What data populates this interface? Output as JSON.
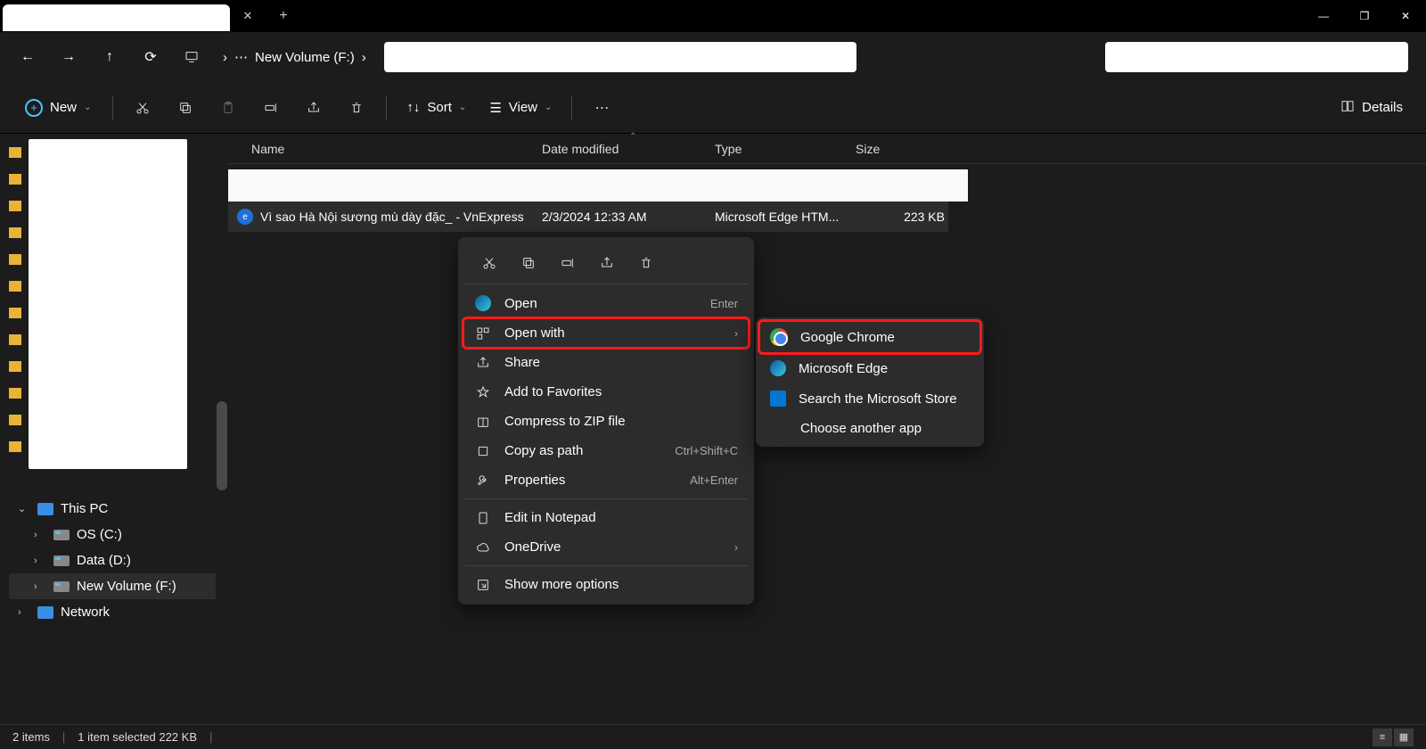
{
  "titlebar": {
    "close": "✕",
    "new": "+",
    "min": "—",
    "max": "❐"
  },
  "nav": {
    "back": "←",
    "fwd": "→",
    "up": "↑",
    "refresh": "⟳"
  },
  "breadcrumb": {
    "location": "New Volume (F:)",
    "chev": "›"
  },
  "toolbar": {
    "new": "New",
    "sort": "Sort",
    "view": "View",
    "details": "Details",
    "cut": "✂",
    "copy": "⧉",
    "paste": "📋",
    "rename": "✎",
    "share": "↗",
    "delete": "🗑",
    "more": "⋯"
  },
  "columns": {
    "name": "Name",
    "date": "Date modified",
    "type": "Type",
    "size": "Size"
  },
  "file": {
    "name": "Vì sao Hà Nội sương mù dày đặc_ - VnExpress",
    "date": "2/3/2024 12:33 AM",
    "type": "Microsoft Edge HTM...",
    "size": "223 KB"
  },
  "tree": {
    "thispc": "This PC",
    "os": "OS (C:)",
    "data": "Data (D:)",
    "vol": "New Volume (F:)",
    "net": "Network"
  },
  "cmenu": {
    "open": "Open",
    "open_sc": "Enter",
    "openwith": "Open with",
    "share": "Share",
    "fav": "Add to Favorites",
    "zip": "Compress to ZIP file",
    "copypath": "Copy as path",
    "copypath_sc": "Ctrl+Shift+C",
    "props": "Properties",
    "props_sc": "Alt+Enter",
    "notepad": "Edit in Notepad",
    "onedrive": "OneDrive",
    "more": "Show more options"
  },
  "submenu": {
    "chrome": "Google Chrome",
    "edge": "Microsoft Edge",
    "store": "Search the Microsoft Store",
    "another": "Choose another app"
  },
  "status": {
    "items": "2 items",
    "selected": "1 item selected  222 KB"
  }
}
